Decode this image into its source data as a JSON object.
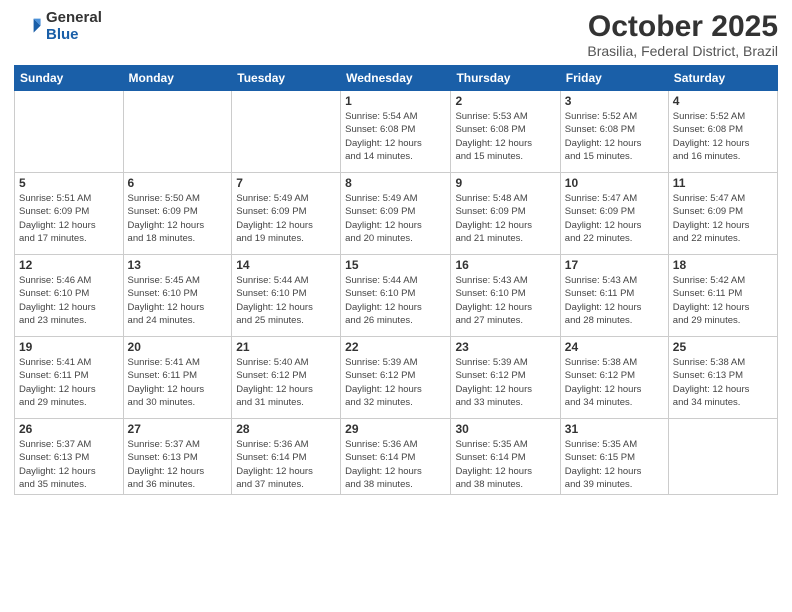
{
  "logo": {
    "general": "General",
    "blue": "Blue"
  },
  "header": {
    "month": "October 2025",
    "location": "Brasilia, Federal District, Brazil"
  },
  "weekdays": [
    "Sunday",
    "Monday",
    "Tuesday",
    "Wednesday",
    "Thursday",
    "Friday",
    "Saturday"
  ],
  "weeks": [
    [
      {
        "num": "",
        "info": ""
      },
      {
        "num": "",
        "info": ""
      },
      {
        "num": "",
        "info": ""
      },
      {
        "num": "1",
        "info": "Sunrise: 5:54 AM\nSunset: 6:08 PM\nDaylight: 12 hours\nand 14 minutes."
      },
      {
        "num": "2",
        "info": "Sunrise: 5:53 AM\nSunset: 6:08 PM\nDaylight: 12 hours\nand 15 minutes."
      },
      {
        "num": "3",
        "info": "Sunrise: 5:52 AM\nSunset: 6:08 PM\nDaylight: 12 hours\nand 15 minutes."
      },
      {
        "num": "4",
        "info": "Sunrise: 5:52 AM\nSunset: 6:08 PM\nDaylight: 12 hours\nand 16 minutes."
      }
    ],
    [
      {
        "num": "5",
        "info": "Sunrise: 5:51 AM\nSunset: 6:09 PM\nDaylight: 12 hours\nand 17 minutes."
      },
      {
        "num": "6",
        "info": "Sunrise: 5:50 AM\nSunset: 6:09 PM\nDaylight: 12 hours\nand 18 minutes."
      },
      {
        "num": "7",
        "info": "Sunrise: 5:49 AM\nSunset: 6:09 PM\nDaylight: 12 hours\nand 19 minutes."
      },
      {
        "num": "8",
        "info": "Sunrise: 5:49 AM\nSunset: 6:09 PM\nDaylight: 12 hours\nand 20 minutes."
      },
      {
        "num": "9",
        "info": "Sunrise: 5:48 AM\nSunset: 6:09 PM\nDaylight: 12 hours\nand 21 minutes."
      },
      {
        "num": "10",
        "info": "Sunrise: 5:47 AM\nSunset: 6:09 PM\nDaylight: 12 hours\nand 22 minutes."
      },
      {
        "num": "11",
        "info": "Sunrise: 5:47 AM\nSunset: 6:09 PM\nDaylight: 12 hours\nand 22 minutes."
      }
    ],
    [
      {
        "num": "12",
        "info": "Sunrise: 5:46 AM\nSunset: 6:10 PM\nDaylight: 12 hours\nand 23 minutes."
      },
      {
        "num": "13",
        "info": "Sunrise: 5:45 AM\nSunset: 6:10 PM\nDaylight: 12 hours\nand 24 minutes."
      },
      {
        "num": "14",
        "info": "Sunrise: 5:44 AM\nSunset: 6:10 PM\nDaylight: 12 hours\nand 25 minutes."
      },
      {
        "num": "15",
        "info": "Sunrise: 5:44 AM\nSunset: 6:10 PM\nDaylight: 12 hours\nand 26 minutes."
      },
      {
        "num": "16",
        "info": "Sunrise: 5:43 AM\nSunset: 6:10 PM\nDaylight: 12 hours\nand 27 minutes."
      },
      {
        "num": "17",
        "info": "Sunrise: 5:43 AM\nSunset: 6:11 PM\nDaylight: 12 hours\nand 28 minutes."
      },
      {
        "num": "18",
        "info": "Sunrise: 5:42 AM\nSunset: 6:11 PM\nDaylight: 12 hours\nand 29 minutes."
      }
    ],
    [
      {
        "num": "19",
        "info": "Sunrise: 5:41 AM\nSunset: 6:11 PM\nDaylight: 12 hours\nand 29 minutes."
      },
      {
        "num": "20",
        "info": "Sunrise: 5:41 AM\nSunset: 6:11 PM\nDaylight: 12 hours\nand 30 minutes."
      },
      {
        "num": "21",
        "info": "Sunrise: 5:40 AM\nSunset: 6:12 PM\nDaylight: 12 hours\nand 31 minutes."
      },
      {
        "num": "22",
        "info": "Sunrise: 5:39 AM\nSunset: 6:12 PM\nDaylight: 12 hours\nand 32 minutes."
      },
      {
        "num": "23",
        "info": "Sunrise: 5:39 AM\nSunset: 6:12 PM\nDaylight: 12 hours\nand 33 minutes."
      },
      {
        "num": "24",
        "info": "Sunrise: 5:38 AM\nSunset: 6:12 PM\nDaylight: 12 hours\nand 34 minutes."
      },
      {
        "num": "25",
        "info": "Sunrise: 5:38 AM\nSunset: 6:13 PM\nDaylight: 12 hours\nand 34 minutes."
      }
    ],
    [
      {
        "num": "26",
        "info": "Sunrise: 5:37 AM\nSunset: 6:13 PM\nDaylight: 12 hours\nand 35 minutes."
      },
      {
        "num": "27",
        "info": "Sunrise: 5:37 AM\nSunset: 6:13 PM\nDaylight: 12 hours\nand 36 minutes."
      },
      {
        "num": "28",
        "info": "Sunrise: 5:36 AM\nSunset: 6:14 PM\nDaylight: 12 hours\nand 37 minutes."
      },
      {
        "num": "29",
        "info": "Sunrise: 5:36 AM\nSunset: 6:14 PM\nDaylight: 12 hours\nand 38 minutes."
      },
      {
        "num": "30",
        "info": "Sunrise: 5:35 AM\nSunset: 6:14 PM\nDaylight: 12 hours\nand 38 minutes."
      },
      {
        "num": "31",
        "info": "Sunrise: 5:35 AM\nSunset: 6:15 PM\nDaylight: 12 hours\nand 39 minutes."
      },
      {
        "num": "",
        "info": ""
      }
    ]
  ]
}
